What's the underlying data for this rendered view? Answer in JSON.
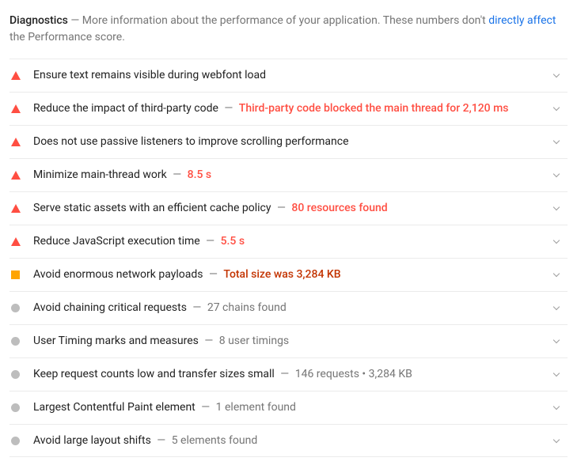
{
  "header": {
    "title": "Diagnostics",
    "sep": " — ",
    "desc_before_link": "More information about the performance of your application. These numbers don't ",
    "link1": "directly affect",
    "desc_after_link": " the Performance score."
  },
  "audits": [
    {
      "icon": "triangle",
      "title": "Ensure text remains visible during webfont load",
      "detail": "",
      "detail_class": ""
    },
    {
      "icon": "triangle",
      "title": "Reduce the impact of third-party code",
      "detail": "Third-party code blocked the main thread for 2,120 ms",
      "detail_class": "detail-red"
    },
    {
      "icon": "triangle",
      "title": "Does not use passive listeners to improve scrolling performance",
      "detail": "",
      "detail_class": ""
    },
    {
      "icon": "triangle",
      "title": "Minimize main-thread work",
      "detail": "8.5 s",
      "detail_class": "detail-red"
    },
    {
      "icon": "triangle",
      "title": "Serve static assets with an efficient cache policy",
      "detail": "80 resources found",
      "detail_class": "detail-red"
    },
    {
      "icon": "triangle",
      "title": "Reduce JavaScript execution time",
      "detail": "5.5 s",
      "detail_class": "detail-red"
    },
    {
      "icon": "square",
      "title": "Avoid enormous network payloads",
      "detail": "Total size was 3,284 KB",
      "detail_class": "detail-orange"
    },
    {
      "icon": "circle",
      "title": "Avoid chaining critical requests",
      "detail": "27 chains found",
      "detail_class": "detail-gray"
    },
    {
      "icon": "circle",
      "title": "User Timing marks and measures",
      "detail": "8 user timings",
      "detail_class": "detail-gray"
    },
    {
      "icon": "circle",
      "title": "Keep request counts low and transfer sizes small",
      "detail": "146 requests • 3,284 KB",
      "detail_class": "detail-gray"
    },
    {
      "icon": "circle",
      "title": "Largest Contentful Paint element",
      "detail": "1 element found",
      "detail_class": "detail-gray"
    },
    {
      "icon": "circle",
      "title": "Avoid large layout shifts",
      "detail": "5 elements found",
      "detail_class": "detail-gray"
    }
  ]
}
